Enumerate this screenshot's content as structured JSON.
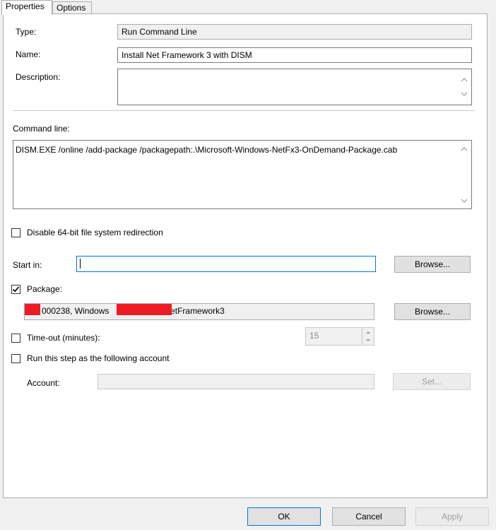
{
  "tabs": [
    {
      "label": "Properties",
      "active": true
    },
    {
      "label": "Options",
      "active": false
    }
  ],
  "fields": {
    "type": {
      "label": "Type:",
      "value": "Run Command Line"
    },
    "name": {
      "label": "Name:",
      "value": "Install Net Framework 3 with DISM"
    },
    "description": {
      "label": "Description:",
      "value": ""
    },
    "command_line": {
      "label": "Command line:",
      "value": "DISM.EXE /online /add-package /packagepath:.\\Microsoft-Windows-NetFx3-OnDemand-Package.cab"
    },
    "start_in": {
      "label": "Start in:",
      "value": ""
    },
    "package": {
      "label": "Package:",
      "value_part1": "000238, Windows",
      "value_part2": "NetFramework3"
    },
    "timeout": {
      "label": "Time-out (minutes):",
      "value": "15"
    },
    "account": {
      "label": "Account:",
      "value": ""
    }
  },
  "checkboxes": {
    "disable_redirection": {
      "label": "Disable 64-bit file system redirection",
      "checked": false
    },
    "package": {
      "checked": true
    },
    "timeout": {
      "checked": false
    },
    "run_as": {
      "label": "Run this step as the following account",
      "checked": false
    }
  },
  "buttons": {
    "browse_start_in": "Browse...",
    "browse_package": "Browse...",
    "set": "Set...",
    "ok": "OK",
    "cancel": "Cancel",
    "apply": "Apply"
  },
  "icons": {
    "checkmark": "checkmark-icon",
    "scroll_up": "chevron-up-icon",
    "scroll_down": "chevron-down-icon"
  },
  "colors": {
    "focus_border": "#0078d7",
    "redaction": "#ed1c24"
  }
}
